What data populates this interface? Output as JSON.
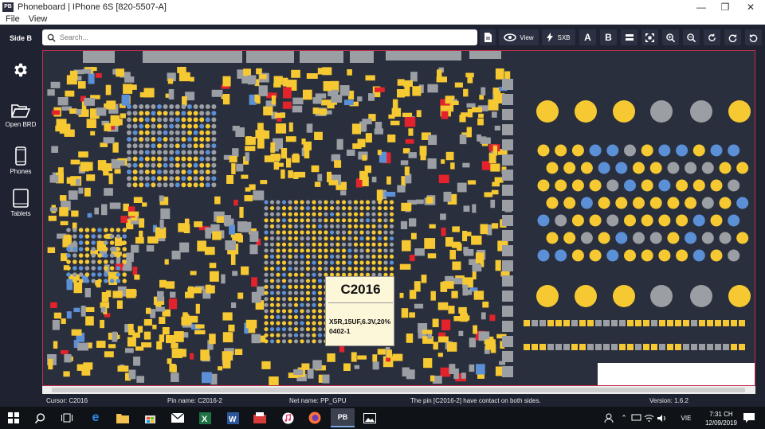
{
  "window": {
    "title": "Phoneboard | IPhone 6S [820-5507-A]",
    "logo": "PB",
    "controls": [
      "minimize-icon",
      "restore-icon",
      "close-icon"
    ]
  },
  "menu": {
    "file": "File",
    "view": "View"
  },
  "toolbar": {
    "side_label": "Side B",
    "search_placeholder": "Search...",
    "view_label": "View",
    "sxb_label": "SXB",
    "a_label": "A",
    "b_label": "B"
  },
  "sidebar": {
    "settings_icon": "gear-icon",
    "open_brd": "Open BRD",
    "phones": "Phones",
    "tablets": "Tablets"
  },
  "tooltip": {
    "title": "C2016",
    "line1": "X5R,15UF,6.3V,20%",
    "line2": "0402-1"
  },
  "status": {
    "cursor": "Cursor: C2016",
    "pin_name": "Pin name: C2016-2",
    "net_name": "Net name: PP_GPU",
    "message": "The pin [C2016-2] have contact on both sides.",
    "version": "Version: 1.6.2"
  },
  "taskbar": {
    "pb_label": "PB",
    "lang": "VIE",
    "time": "7:31 CH",
    "date": "12/09/2019"
  },
  "colors": {
    "pad_yellow": "#f6c932",
    "pad_gray": "#9b9ea3",
    "pad_red": "#e3232c",
    "pad_blue": "#5b8fd6",
    "board_bg": "#2a2f3d"
  }
}
